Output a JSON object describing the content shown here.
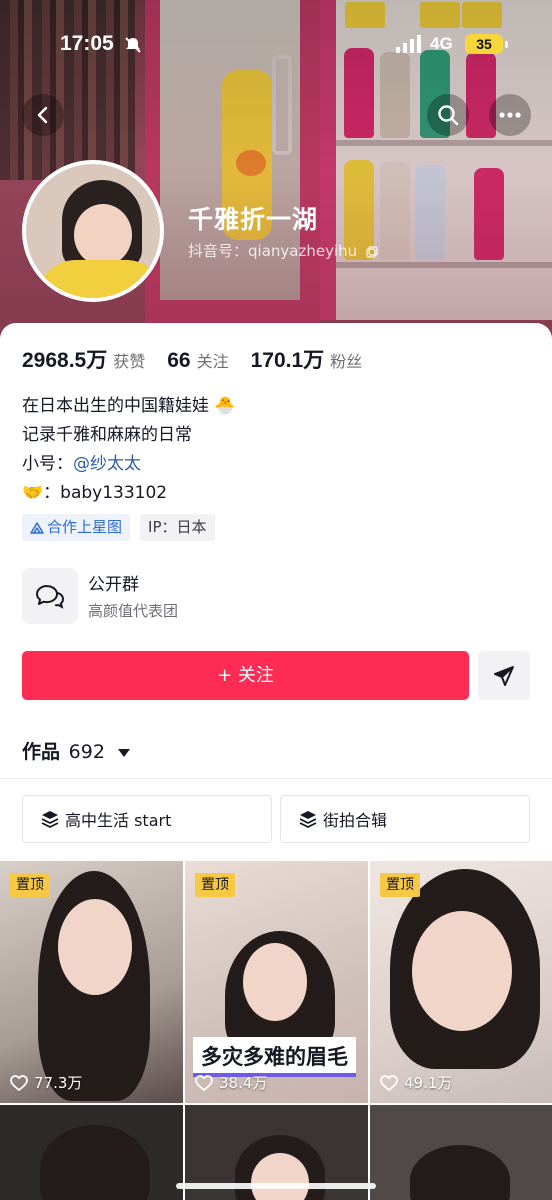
{
  "status_bar": {
    "time": "17:05",
    "network": "4G",
    "battery": "35"
  },
  "profile": {
    "name": "千雅折一湖",
    "douyin_id": "抖音号：qianyazheyihu",
    "stats": [
      {
        "value": "2968.5万",
        "label": "获赞"
      },
      {
        "value": "66",
        "label": "关注"
      },
      {
        "value": "170.1万",
        "label": "粉丝"
      }
    ],
    "bio": {
      "line1": "在日本出生的中国籍娃娃 🐣",
      "line2": "记录千雅和麻麻的日常",
      "alt_prefix": "小号：",
      "alt_link": "@纱太太",
      "contact": "🤝：baby133102"
    },
    "tags": {
      "star": "合作上星图",
      "ip": "IP：日本"
    },
    "group": {
      "title": "公开群",
      "subtitle": "高颜值代表团"
    }
  },
  "actions": {
    "follow_label": "+ 关注"
  },
  "works": {
    "label": "作品",
    "count": "692"
  },
  "collections": [
    {
      "label": "高中生活 start"
    },
    {
      "label": "街拍合辑"
    }
  ],
  "videos": [
    {
      "pinned": "置顶",
      "likes": "77.3万"
    },
    {
      "pinned": "置顶",
      "likes": "38.4万",
      "caption": "多灾多难的眉毛"
    },
    {
      "pinned": "置顶",
      "likes": "49.1万"
    }
  ],
  "colors": {
    "accent": "#fe2c55",
    "pin": "#f6c843",
    "link": "#2c5ba8"
  },
  "icons": [
    "back-icon",
    "search-icon",
    "more-icon",
    "copy-icon",
    "chat-group-icon",
    "share-icon",
    "stack-icon",
    "heart-icon",
    "mute-icon",
    "signal-icon"
  ]
}
